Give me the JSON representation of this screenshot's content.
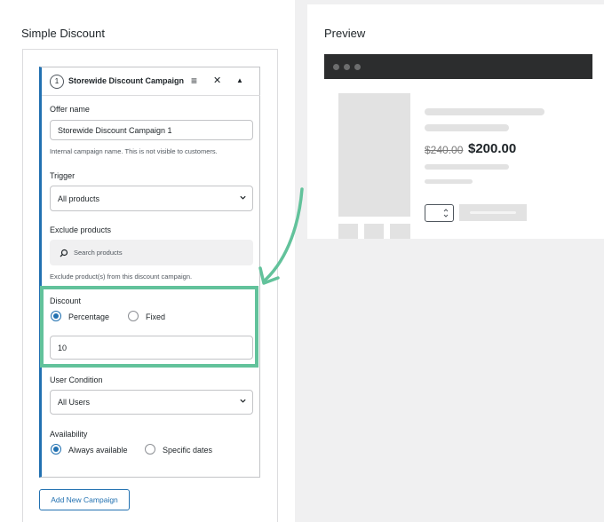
{
  "left": {
    "title": "Simple Discount",
    "campaign": {
      "step": "1",
      "title": "Storewide Discount Campaign",
      "offer_name_label": "Offer name",
      "offer_name_value": "Storewide Discount Campaign 1",
      "offer_name_help": "Internal campaign name. This is not visible to customers.",
      "trigger_label": "Trigger",
      "trigger_value": "All products",
      "exclude_label": "Exclude products",
      "exclude_placeholder": "Search products",
      "exclude_help": "Exclude product(s) from this discount campaign.",
      "discount_label": "Discount",
      "discount_options": [
        "Percentage",
        "Fixed"
      ],
      "discount_selected": "Percentage",
      "discount_value": "10",
      "user_condition_label": "User Condition",
      "user_condition_value": "All Users",
      "availability_label": "Availability",
      "availability_options": [
        "Always available",
        "Specific dates"
      ],
      "availability_selected": "Always available"
    },
    "add_button": "Add New Campaign"
  },
  "preview": {
    "title": "Preview",
    "old_price": "$240.00",
    "new_price": "$200.00"
  },
  "colors": {
    "accent": "#2271b1",
    "highlight": "#62c29b",
    "browser_bar": "#2c2d2e"
  },
  "icons": [
    "drag-handle-icon",
    "close-icon",
    "collapse-arrow-icon",
    "chevron-down-icon",
    "search-icon",
    "arrow-icon"
  ]
}
